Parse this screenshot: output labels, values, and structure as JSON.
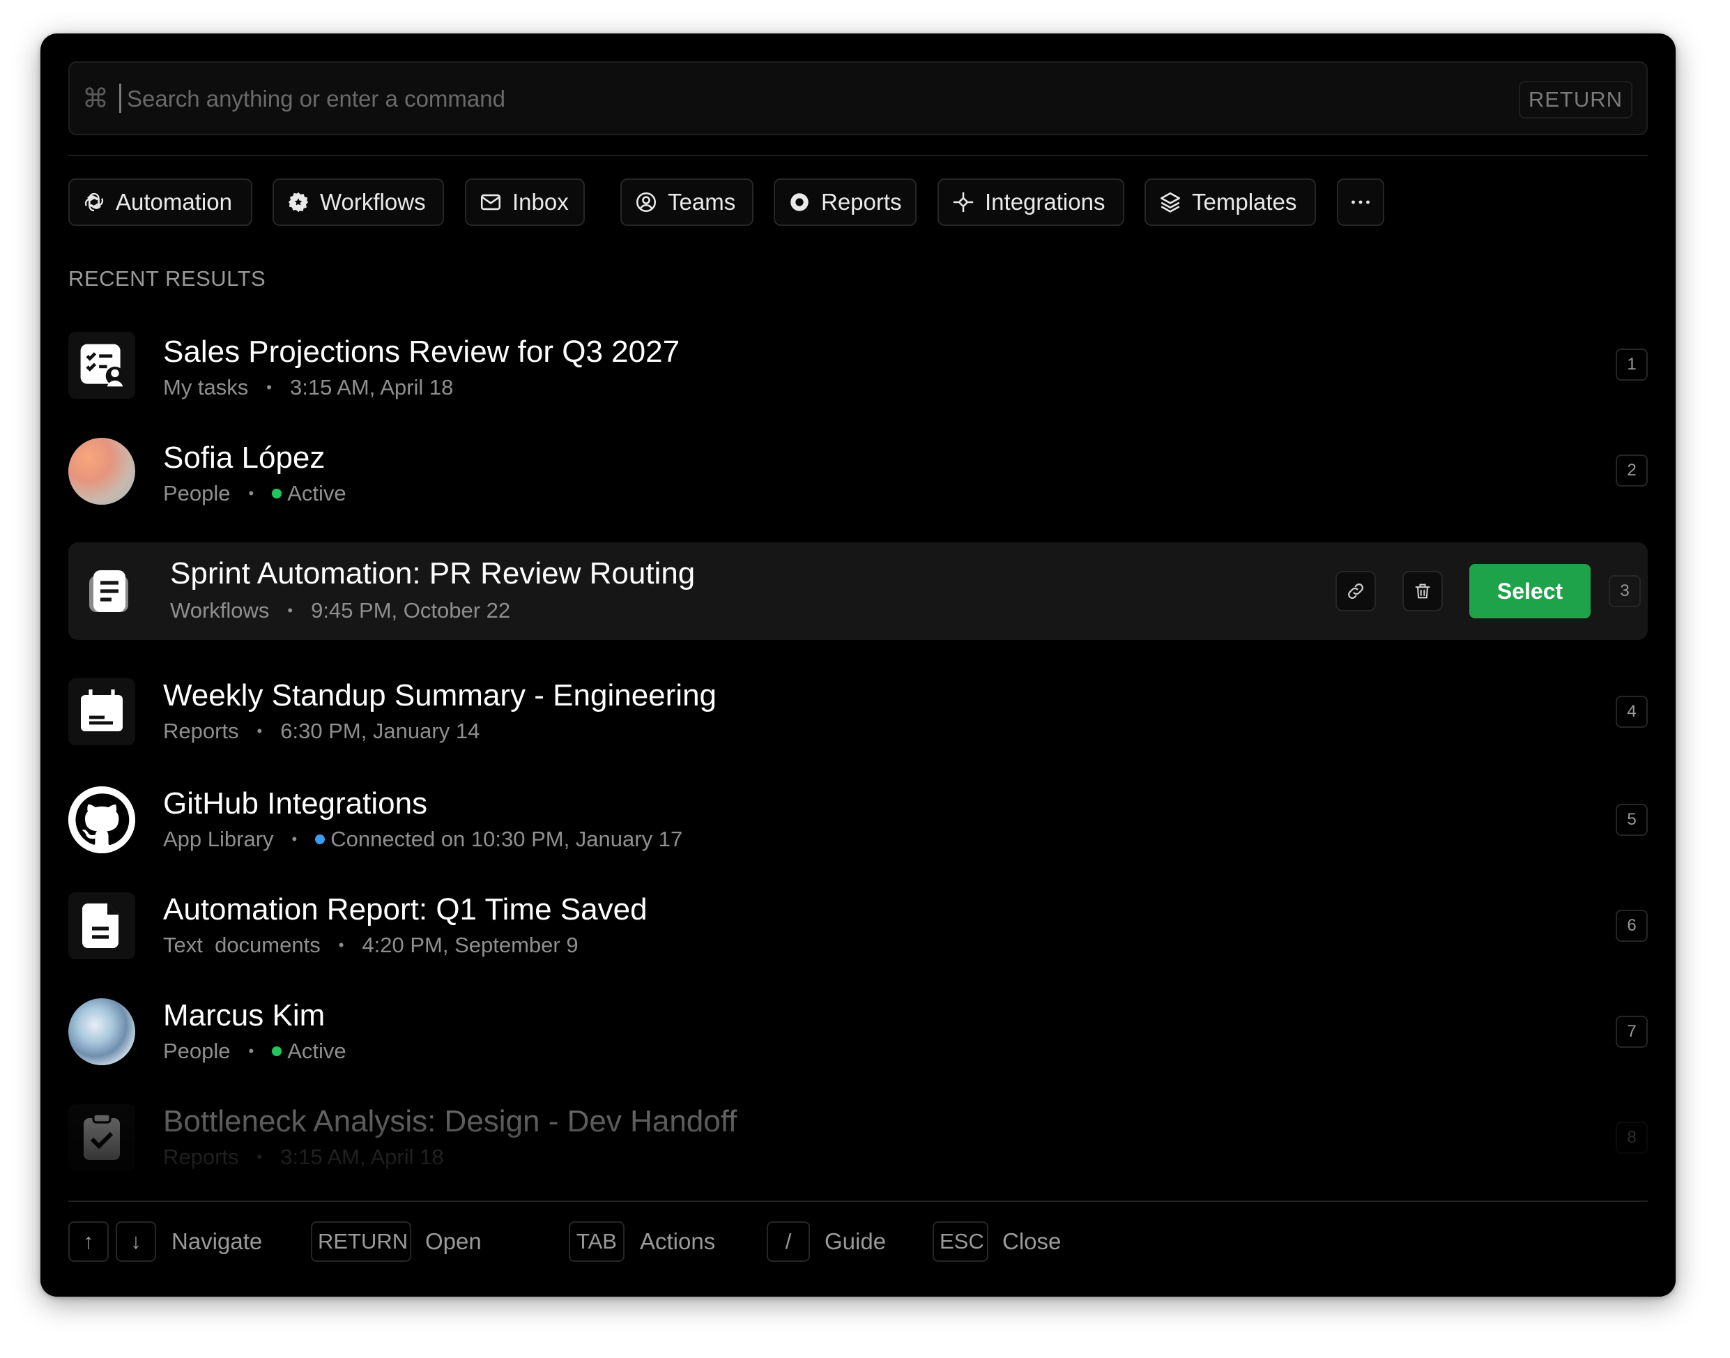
{
  "search": {
    "icon": "command-icon",
    "placeholder": "Search anything or enter a command",
    "return_key": "RETURN"
  },
  "chips": [
    {
      "label": "Automation",
      "icon": "openai-icon"
    },
    {
      "label": "Workflows",
      "icon": "gear-badge-icon"
    },
    {
      "label": "Inbox",
      "icon": "mail-icon"
    },
    {
      "label": "Teams",
      "icon": "user-circle-icon"
    },
    {
      "label": "Reports",
      "icon": "record-icon"
    },
    {
      "label": "Integrations",
      "icon": "nodes-icon"
    },
    {
      "label": "Templates",
      "icon": "layers-icon"
    }
  ],
  "more_label": "···",
  "section_label": "RECENT RESULTS",
  "results": [
    {
      "title": "Sales Projections Review for Q3 2027",
      "category": "My tasks",
      "detail": "3:15 AM, April 18",
      "num": "1",
      "icon": "task-list-icon"
    },
    {
      "title": "Sofia López",
      "category": "People",
      "detail": "Active",
      "status_color": "#22c55e",
      "num": "2",
      "icon": "avatar"
    },
    {
      "title": "Sprint Automation: PR Review Routing",
      "category": "Workflows",
      "detail": "9:45  PM, October 22",
      "num": "3",
      "icon": "document-icon",
      "actions": {
        "select_label": "Select"
      }
    },
    {
      "title": "Weekly Standup Summary - Engineering",
      "category": "Reports",
      "detail": "6:30 PM, January 14",
      "num": "4",
      "icon": "calendar-icon"
    },
    {
      "title": "GitHub Integrations",
      "category": "App Library",
      "detail": "Connected on 10:30 PM, January 17",
      "status_color": "#3b9cf0",
      "num": "5",
      "icon": "github-icon"
    },
    {
      "title": "Automation Report: Q1 Time Saved",
      "category": "Text  documents",
      "detail": "4:20 PM, September 9",
      "num": "6",
      "icon": "file-icon"
    },
    {
      "title": "Marcus Kim",
      "category": "People",
      "detail": "Active",
      "status_color": "#22c55e",
      "num": "7",
      "icon": "avatar"
    },
    {
      "title": "Bottleneck Analysis: Design - Dev Handoff",
      "category": "Reports",
      "detail": "3:15 AM, April 18",
      "num": "8",
      "icon": "clipboard-check-icon"
    }
  ],
  "footer": {
    "up_key": "↑",
    "down_key": "↓",
    "navigate": "Navigate",
    "return_key": "RETURN",
    "open": "Open",
    "tab_key": "TAB",
    "actions": "Actions",
    "slash_key": "/",
    "guide": "Guide",
    "esc_key": "ESC",
    "close": "Close"
  },
  "colors": {
    "background": "#000000",
    "select_button": "#1fa34a",
    "active_status": "#22c55e",
    "connected_status": "#3b9cf0"
  }
}
